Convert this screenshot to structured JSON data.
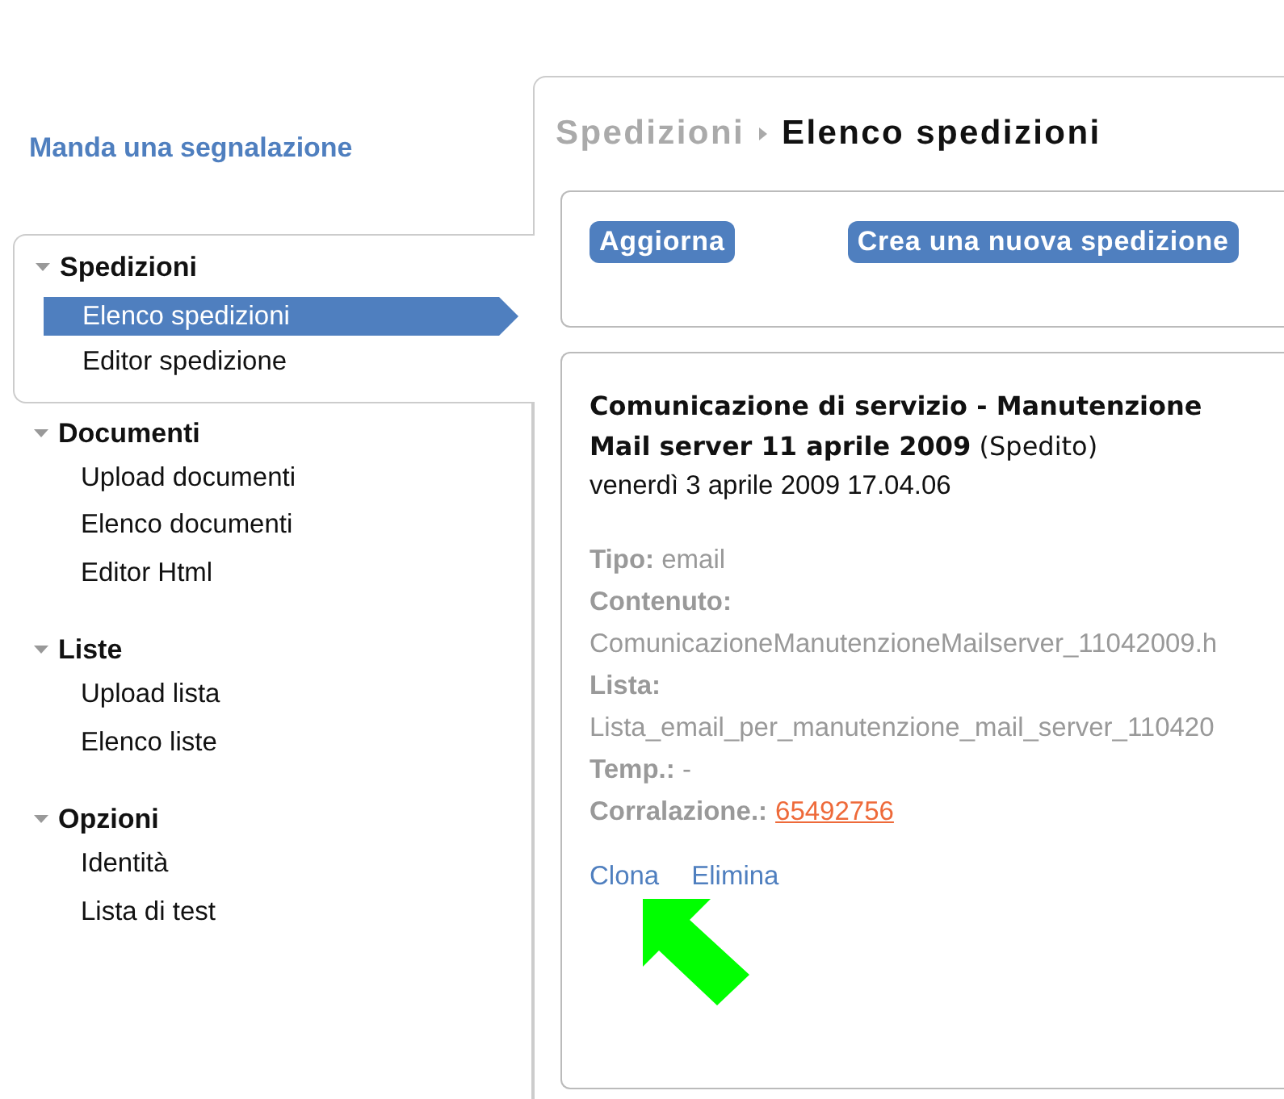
{
  "sidebar": {
    "report_link": "Manda una segnalazione",
    "groups": [
      {
        "title": "Spedizioni",
        "expanded": true,
        "active": true,
        "items": [
          {
            "label": "Elenco spedizioni",
            "selected": true
          },
          {
            "label": "Editor spedizione",
            "selected": false
          }
        ]
      },
      {
        "title": "Documenti",
        "expanded": true,
        "active": false,
        "items": [
          {
            "label": "Upload documenti",
            "selected": false
          },
          {
            "label": "Elenco documenti",
            "selected": false
          },
          {
            "label": "Editor Html",
            "selected": false
          }
        ]
      },
      {
        "title": "Liste",
        "expanded": true,
        "active": false,
        "items": [
          {
            "label": "Upload lista",
            "selected": false
          },
          {
            "label": "Elenco liste",
            "selected": false
          }
        ]
      },
      {
        "title": "Opzioni",
        "expanded": true,
        "active": false,
        "items": [
          {
            "label": "Identità",
            "selected": false
          },
          {
            "label": "Lista di test",
            "selected": false
          }
        ]
      }
    ]
  },
  "breadcrumb": {
    "parent": "Spedizioni",
    "current": "Elenco spedizioni"
  },
  "toolbar": {
    "buttons": [
      "Aggiorna",
      "Crea una nuova spedizione"
    ]
  },
  "shipment": {
    "title": "**Comunicazione di servizio - Manutenzione Mail server 11 aprile 2009** (Spedito)",
    "date": "venerdì 3 aprile 2009 17.04.06",
    "fields": [
      {
        "kind": "inline",
        "label": "Tipo:",
        "value": "email"
      },
      {
        "kind": "block",
        "label": "Contenuto:",
        "value": "ComunicazioneManutenzioneMailserver_11042009.h"
      },
      {
        "kind": "block",
        "label": "Lista:",
        "value": "Lista_email_per_manutenzione_mail_server_110420"
      },
      {
        "kind": "text",
        "text": "**Temp.:** -"
      },
      {
        "kind": "link",
        "label": "Corralazione.:",
        "value": "65492756"
      }
    ],
    "actions": [
      "Clona",
      "Elimina"
    ]
  }
}
